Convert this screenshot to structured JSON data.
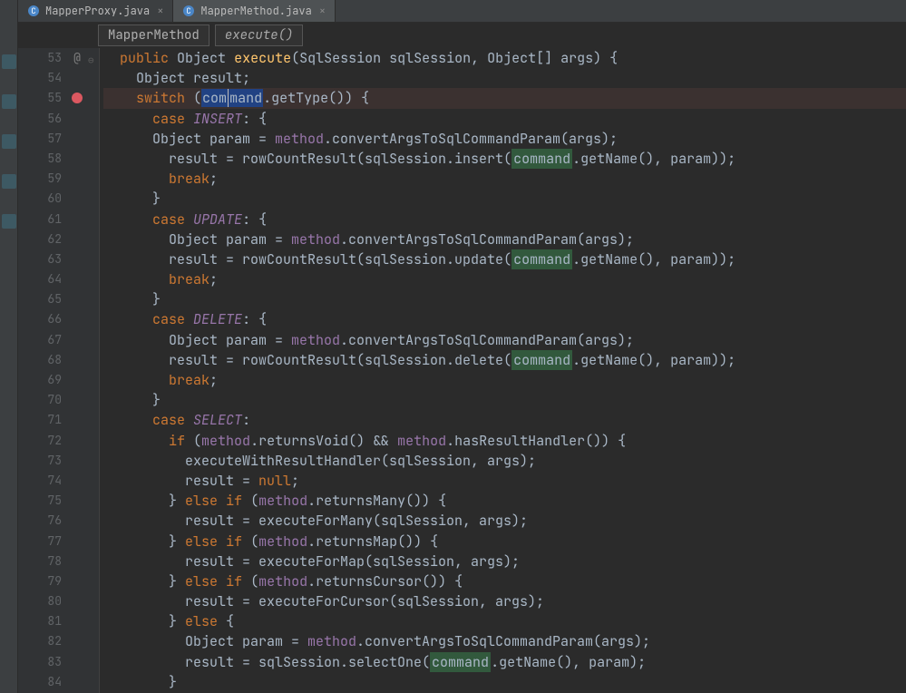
{
  "tabs": [
    {
      "name": "MapperProxy.java",
      "active": false
    },
    {
      "name": "MapperMethod.java",
      "active": true
    }
  ],
  "breadcrumb": {
    "class": "MapperMethod",
    "method": "execute()"
  },
  "lines": {
    "start": 53,
    "end": 84,
    "breakpoint": 55,
    "highlight": 55,
    "at_sign_line": 53,
    "fold_line": 53
  },
  "tokens": {
    "public": "public",
    "object": "Object",
    "execute": "execute",
    "sig": "(SqlSession sqlSession, Object[] args) {",
    "result_id": "result",
    "switch": "switch",
    "command": "command",
    "getType": ".getType()) {",
    "case": "case",
    "insert_c": "INSERT",
    "update_c": "UPDATE",
    "delete_c": "DELETE",
    "select_c": "SELECT",
    "object_param": "Object param = ",
    "method": "method",
    "convert": ".convertArgsToSqlCommandParam(args);",
    "result_eq": "result = ",
    "rowCount": "rowCountResult",
    "ins": "(sqlSession.insert(",
    "upd": "(sqlSession.update(",
    "del": "(sqlSession.delete(",
    "getName": ".getName(), param));",
    "break": "break",
    "if": "if",
    "else": "else",
    "returnsVoid": ".returnsVoid() && ",
    "hasRH": ".hasResultHandler()) {",
    "execRH": "executeWithResultHandler",
    "args1": "(sqlSession, args);",
    "null": "null",
    "returnsMany": ".returnsMany()) {",
    "returnsMap": ".returnsMap()) {",
    "returnsCursor": ".returnsCursor()) {",
    "execMany": "executeForMany",
    "execMap": "executeForMap",
    "execCursor": "executeForCursor",
    "selectOne": "sqlSession.selectOne(",
    "getName2": ".getName(), param);"
  }
}
